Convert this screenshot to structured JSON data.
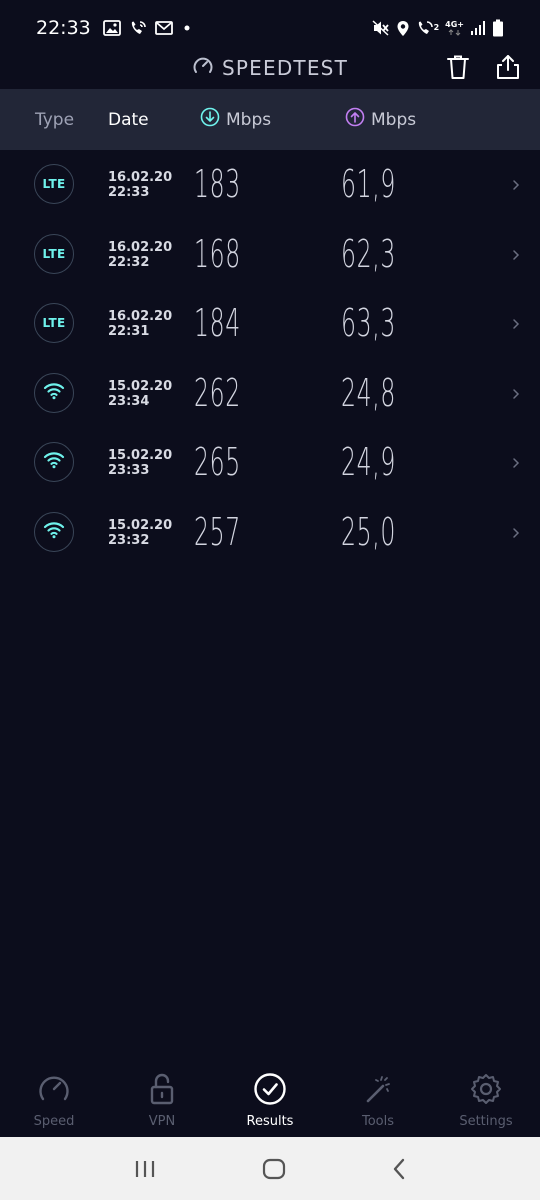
{
  "status_bar": {
    "time": "22:33",
    "network": "4G+",
    "sim_slot": "2",
    "icons": [
      "image-icon",
      "wifi-call-icon",
      "mail-icon",
      "dot-icon",
      "mute-icon",
      "location-icon",
      "call-icon",
      "signal-icon",
      "battery-icon"
    ]
  },
  "header": {
    "title": "SPEEDTEST",
    "icons": [
      "speedometer-logo-icon",
      "trash-icon",
      "share-icon"
    ]
  },
  "columns": {
    "type": "Type",
    "date": "Date",
    "download": "Mbps",
    "upload": "Mbps"
  },
  "colors": {
    "background": "#0c0d1c",
    "header_band": "#222637",
    "download_accent": "#6ff2ec",
    "upload_accent": "#c27ff2",
    "active_nav": "#ffffff",
    "inactive_nav": "#5a5e70"
  },
  "results": [
    {
      "type": "LTE",
      "date": "16.02.20",
      "time": "22:33",
      "download": "183",
      "upload": "61,9"
    },
    {
      "type": "LTE",
      "date": "16.02.20",
      "time": "22:32",
      "download": "168",
      "upload": "62,3"
    },
    {
      "type": "LTE",
      "date": "16.02.20",
      "time": "22:31",
      "download": "184",
      "upload": "63,3"
    },
    {
      "type": "wifi",
      "date": "15.02.20",
      "time": "23:34",
      "download": "262",
      "upload": "24,8"
    },
    {
      "type": "wifi",
      "date": "15.02.20",
      "time": "23:33",
      "download": "265",
      "upload": "24,9"
    },
    {
      "type": "wifi",
      "date": "15.02.20",
      "time": "23:32",
      "download": "257",
      "upload": "25,0"
    }
  ],
  "nav": [
    {
      "label": "Speed",
      "icon": "speedometer-icon",
      "active": false
    },
    {
      "label": "VPN",
      "icon": "lock-open-icon",
      "active": false
    },
    {
      "label": "Results",
      "icon": "check-circle-icon",
      "active": true
    },
    {
      "label": "Tools",
      "icon": "magic-wand-icon",
      "active": false
    },
    {
      "label": "Settings",
      "icon": "gear-icon",
      "active": false
    }
  ],
  "system_nav": [
    "recents-icon",
    "home-icon",
    "back-icon"
  ]
}
